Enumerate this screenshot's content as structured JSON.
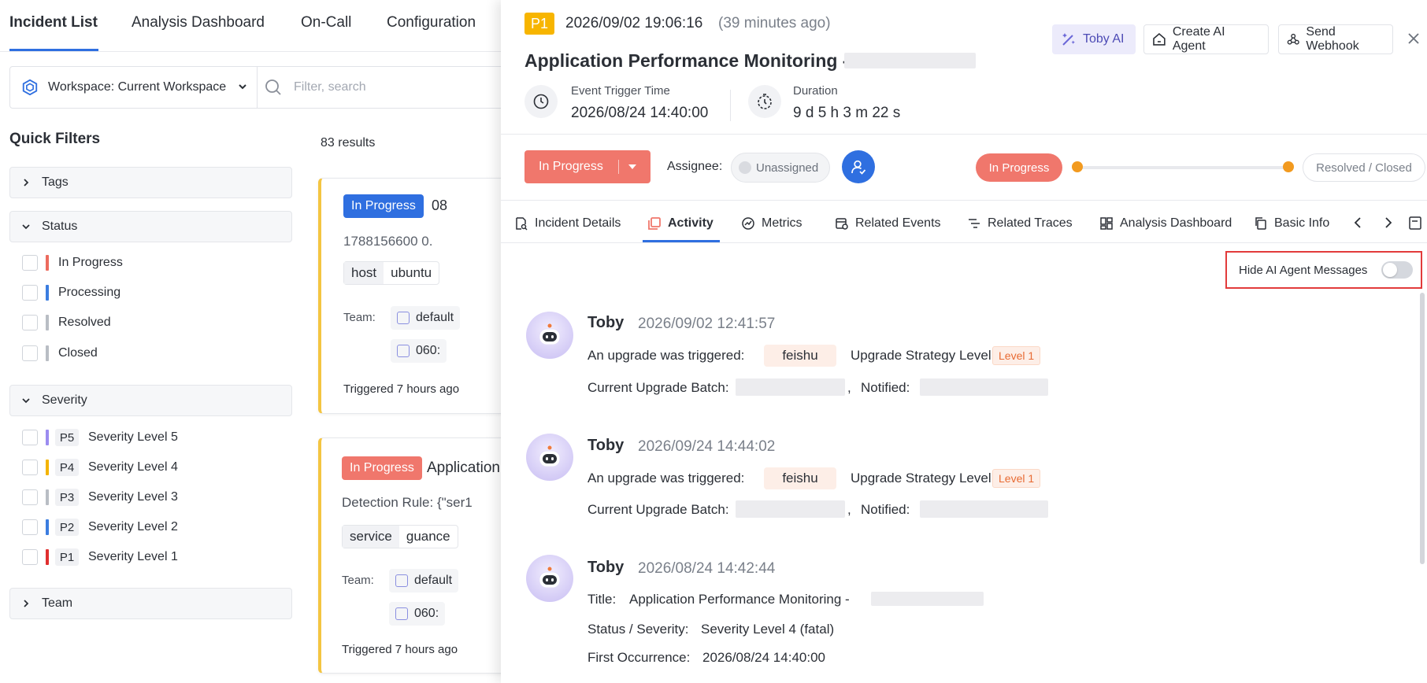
{
  "nav": {
    "tabs": [
      {
        "label": "Incident List"
      },
      {
        "label": "Analysis Dashboard"
      },
      {
        "label": "On-Call"
      },
      {
        "label": "Configuration"
      }
    ]
  },
  "filterbar": {
    "workspace_label": "Workspace:  Current Workspace",
    "search_placeholder": "Filter, search"
  },
  "quick_filters": {
    "title": "Quick Filters",
    "groups": {
      "tags": "Tags",
      "status": "Status",
      "severity": "Severity",
      "team": "Team"
    },
    "status_items": [
      {
        "label": "In Progress",
        "color": "#ec6b5e"
      },
      {
        "label": "Processing",
        "color": "#3b7de0"
      },
      {
        "label": "Resolved",
        "color": "#b9bdc4"
      },
      {
        "label": "Closed",
        "color": "#b9bdc4"
      }
    ],
    "severity_items": [
      {
        "code": "P5",
        "label": "Severity Level 5",
        "color": "#9b8cf0"
      },
      {
        "code": "P4",
        "label": "Severity Level 4",
        "color": "#f4b400"
      },
      {
        "code": "P3",
        "label": "Severity Level 3",
        "color": "#b9bdc4"
      },
      {
        "code": "P2",
        "label": "Severity Level 2",
        "color": "#3b7de0"
      },
      {
        "code": "P1",
        "label": "Severity Level 1",
        "color": "#e02f2f"
      }
    ]
  },
  "results": "83 results",
  "cards": [
    {
      "status": "In Progress",
      "title": "08",
      "subtitle": "1788156600 0.",
      "tag_key": "host",
      "tag_value": "ubuntu",
      "team_label": "Team:",
      "team_1": "default",
      "team_2": "060:",
      "triggered": "Triggered 7 hours ago"
    },
    {
      "status": "In Progress",
      "title": "Application",
      "subtitle": "Detection Rule: {\"ser1",
      "tag_key": "service",
      "tag_value": "guance",
      "team_label": "Team:",
      "team_1": "default",
      "team_2": "060:",
      "triggered": "Triggered 7 hours ago"
    }
  ],
  "drawer": {
    "severity": "P1",
    "timestamp": "2026/09/02 19:06:16",
    "ago": "(39 minutes ago)",
    "title": "Application Performance Monitoring -",
    "buttons": {
      "toby": "Toby AI",
      "create_agent": "Create AI Agent",
      "webhook": "Send Webhook"
    },
    "trigger_label": "Event Trigger Time",
    "trigger_value": "2026/08/24 14:40:00",
    "duration_label": "Duration",
    "duration_value": "9 d 5 h 3 m 22 s",
    "status_button": "In Progress",
    "assignee_label": "Assignee:",
    "assignee_value": "Unassigned",
    "progress_current": "In Progress",
    "progress_end": "Resolved / Closed",
    "tabs": [
      {
        "label": "Incident Details"
      },
      {
        "label": "Activity"
      },
      {
        "label": "Metrics"
      },
      {
        "label": "Related Events"
      },
      {
        "label": "Related Traces"
      },
      {
        "label": "Analysis Dashboard"
      },
      {
        "label": "Basic Info"
      }
    ],
    "hide_ai_label": "Hide AI Agent Messages",
    "hide_ai_enabled": false,
    "activities": [
      {
        "name": "Toby",
        "time": "2026/09/02 12:41:57",
        "upgrade_label": "An upgrade was triggered:",
        "channel": "feishu",
        "strategy_label": "Upgrade Strategy Level",
        "level": "Level 1",
        "batch_label": "Current Upgrade Batch:",
        "comma": ",",
        "notified_label": "Notified:"
      },
      {
        "name": "Toby",
        "time": "2026/09/24 14:44:02",
        "upgrade_label": "An upgrade was triggered:",
        "channel": "feishu",
        "strategy_label": "Upgrade Strategy Level",
        "level": "Level 1",
        "batch_label": "Current Upgrade Batch:",
        "comma": ",",
        "notified_label": "Notified:"
      },
      {
        "name": "Toby",
        "time": "2026/08/24 14:42:44",
        "title_label": "Title:",
        "title_value": "Application Performance Monitoring -",
        "status_label": "Status / Severity:",
        "status_value": "Severity Level 4 (fatal)",
        "first_label": "First Occurrence:",
        "first_value": "2026/08/24 14:40:00"
      }
    ]
  },
  "colors": {
    "accent": "#2f6fe0",
    "in_progress": "#f0776c",
    "p1": "#f7b500",
    "highlight_box": "#e23b3b"
  }
}
